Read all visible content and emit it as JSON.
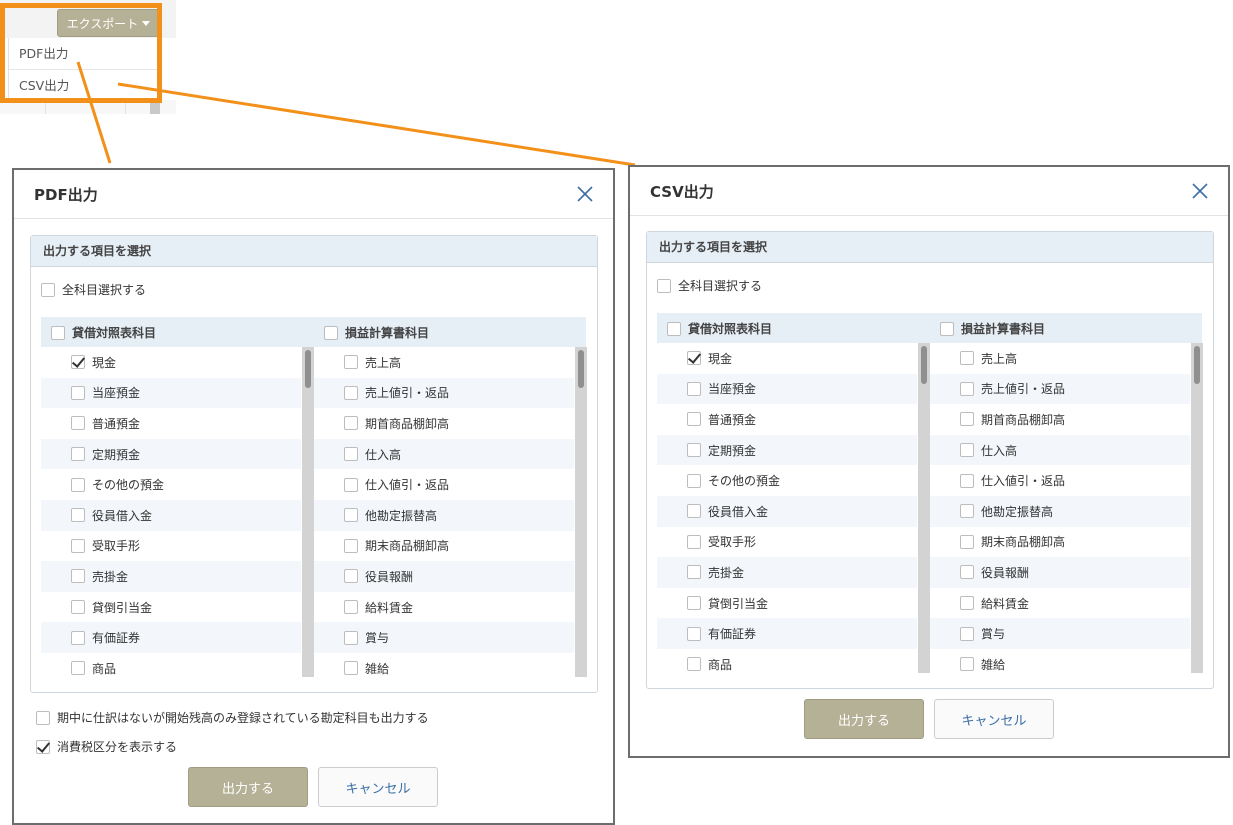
{
  "export": {
    "button_label": "エクスポート",
    "menu_items": [
      "PDF出力",
      "CSV出力"
    ]
  },
  "colors": {
    "highlight": "#f39019",
    "primary_button": "#b5b196",
    "panel_header": "#e6eef6",
    "link": "#3a6ea5"
  },
  "icons": {
    "close": "close-icon",
    "caret": "caret-down-icon",
    "checkbox": "checkbox-icon"
  },
  "pdf_dialog": {
    "title": "PDF出力",
    "panel_title": "出力する項目を選択",
    "select_all": "全科目選択する",
    "left_column_title": "貸借対照表科目",
    "right_column_title": "損益計算書科目",
    "left_items": [
      {
        "label": "現金",
        "checked": true
      },
      {
        "label": "当座預金",
        "checked": false
      },
      {
        "label": "普通預金",
        "checked": false
      },
      {
        "label": "定期預金",
        "checked": false
      },
      {
        "label": "その他の預金",
        "checked": false
      },
      {
        "label": "役員借入金",
        "checked": false
      },
      {
        "label": "受取手形",
        "checked": false
      },
      {
        "label": "売掛金",
        "checked": false
      },
      {
        "label": "貸倒引当金",
        "checked": false
      },
      {
        "label": "有価証券",
        "checked": false
      },
      {
        "label": "商品",
        "checked": false
      }
    ],
    "right_items": [
      {
        "label": "売上高",
        "checked": false
      },
      {
        "label": "売上値引・返品",
        "checked": false
      },
      {
        "label": "期首商品棚卸高",
        "checked": false
      },
      {
        "label": "仕入高",
        "checked": false
      },
      {
        "label": "仕入値引・返品",
        "checked": false
      },
      {
        "label": "他勘定振替高",
        "checked": false
      },
      {
        "label": "期末商品棚卸高",
        "checked": false
      },
      {
        "label": "役員報酬",
        "checked": false
      },
      {
        "label": "給料賃金",
        "checked": false
      },
      {
        "label": "賞与",
        "checked": false
      },
      {
        "label": "雑給",
        "checked": false
      }
    ],
    "option_opening_balance": "期中に仕訳はないが開始残高のみ登録されている勘定科目も出力する",
    "option_tax": "消費税区分を表示する",
    "option_tax_checked": true,
    "submit_label": "出力する",
    "cancel_label": "キャンセル"
  },
  "csv_dialog": {
    "title": "CSV出力",
    "panel_title": "出力する項目を選択",
    "select_all": "全科目選択する",
    "left_column_title": "貸借対照表科目",
    "right_column_title": "損益計算書科目",
    "left_items": [
      {
        "label": "現金",
        "checked": true
      },
      {
        "label": "当座預金",
        "checked": false
      },
      {
        "label": "普通預金",
        "checked": false
      },
      {
        "label": "定期預金",
        "checked": false
      },
      {
        "label": "その他の預金",
        "checked": false
      },
      {
        "label": "役員借入金",
        "checked": false
      },
      {
        "label": "受取手形",
        "checked": false
      },
      {
        "label": "売掛金",
        "checked": false
      },
      {
        "label": "貸倒引当金",
        "checked": false
      },
      {
        "label": "有価証券",
        "checked": false
      },
      {
        "label": "商品",
        "checked": false
      }
    ],
    "right_items": [
      {
        "label": "売上高",
        "checked": false
      },
      {
        "label": "売上値引・返品",
        "checked": false
      },
      {
        "label": "期首商品棚卸高",
        "checked": false
      },
      {
        "label": "仕入高",
        "checked": false
      },
      {
        "label": "仕入値引・返品",
        "checked": false
      },
      {
        "label": "他勘定振替高",
        "checked": false
      },
      {
        "label": "期末商品棚卸高",
        "checked": false
      },
      {
        "label": "役員報酬",
        "checked": false
      },
      {
        "label": "給料賃金",
        "checked": false
      },
      {
        "label": "賞与",
        "checked": false
      },
      {
        "label": "雑給",
        "checked": false
      }
    ],
    "submit_label": "出力する",
    "cancel_label": "キャンセル"
  }
}
